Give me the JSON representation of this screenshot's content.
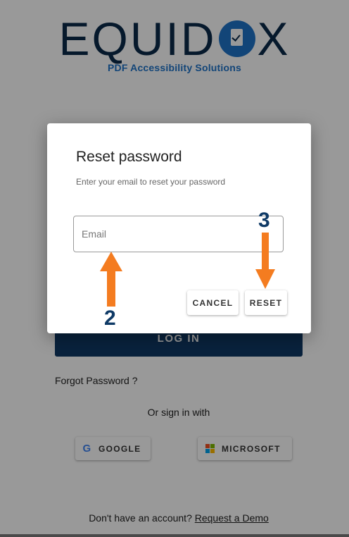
{
  "logo": {
    "word_before": "EQUID",
    "word_after": "X",
    "tagline": "PDF Accessibility Solutions"
  },
  "login": {
    "login_button": "LOG IN",
    "forgot_password": "Forgot Password ?",
    "or_sign_in": "Or sign in with",
    "google_label": "GOOGLE",
    "microsoft_label": "MICROSOFT",
    "signup_prompt": "Don't have an account?",
    "signup_link": "Request a Demo"
  },
  "dialog": {
    "title": "Reset password",
    "subtitle": "Enter your email to reset your password",
    "email_placeholder": "Email",
    "email_value": "",
    "cancel_label": "CANCEL",
    "reset_label": "RESET"
  },
  "annotations": {
    "step_email": "2",
    "step_reset": "3",
    "arrow_color": "#f47c20"
  },
  "colors": {
    "brand_navy": "#0b2a4a",
    "brand_blue": "#1e73c9",
    "login_button": "#0f3a66",
    "google_blue": "#4285f4",
    "ms_red": "#f25022",
    "ms_green": "#7fba00",
    "ms_blue": "#00a4ef",
    "ms_yellow": "#ffb900"
  }
}
